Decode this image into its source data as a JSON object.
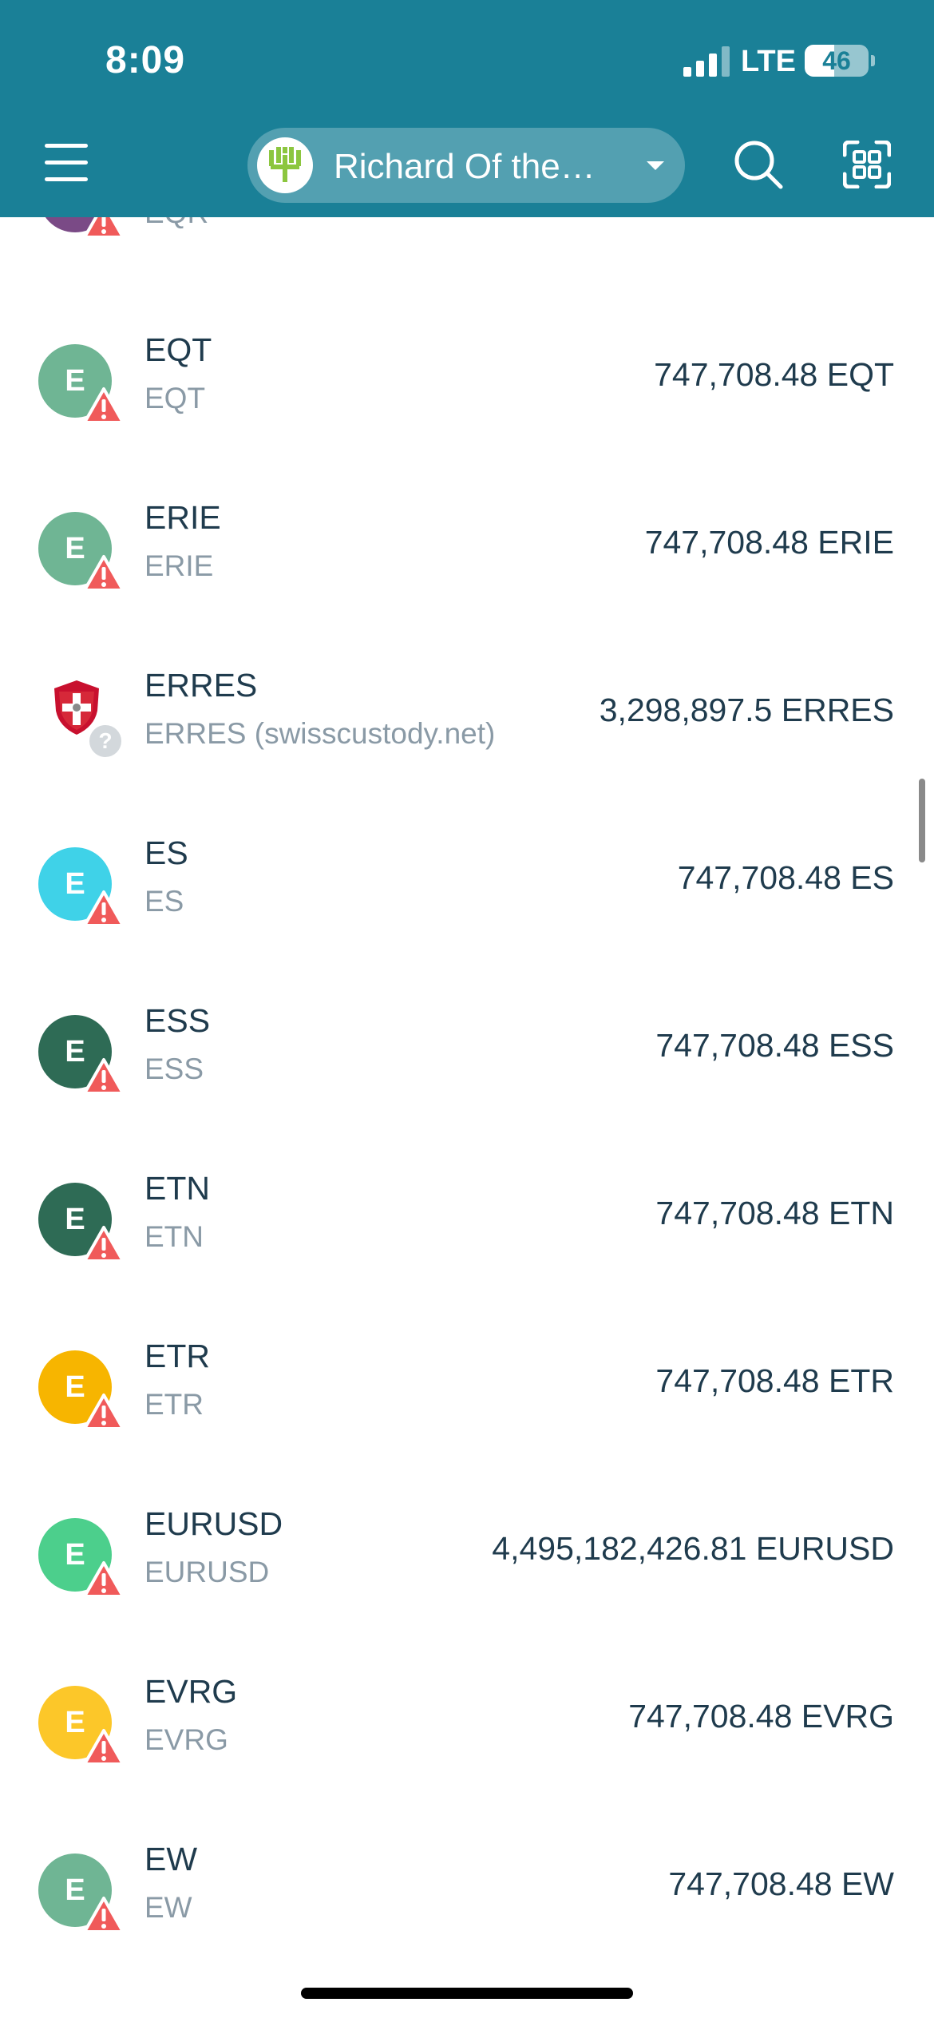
{
  "status_bar": {
    "time": "8:09",
    "network": "LTE",
    "battery": "46",
    "battery_level": 0.46
  },
  "header": {
    "wallet_name": "Richard Of the…",
    "menu_icon": "hamburger-menu-icon",
    "search_icon": "search-icon",
    "scan_icon": "qr-scan-icon",
    "accent": "#1a8097"
  },
  "tokens": [
    {
      "name": "",
      "sub": "EQR",
      "balance": "",
      "initial": "E",
      "color": "#7a4a86",
      "badge": "warning"
    },
    {
      "name": "EQT",
      "sub": "EQT",
      "balance": "747,708.48 EQT",
      "initial": "E",
      "color": "#6fb594",
      "badge": "warning"
    },
    {
      "name": "ERIE",
      "sub": "ERIE",
      "balance": "747,708.48 ERIE",
      "initial": "E",
      "color": "#6fb594",
      "badge": "warning"
    },
    {
      "name": "ERRES",
      "sub": "ERRES (swisscustody.net)",
      "balance": "3,298,897.5 ERRES",
      "initial": "",
      "color": "#ffffff",
      "badge": "unknown",
      "icon": "shield-cross-icon"
    },
    {
      "name": "ES",
      "sub": "ES",
      "balance": "747,708.48 ES",
      "initial": "E",
      "color": "#3fd2e8",
      "badge": "warning"
    },
    {
      "name": "ESS",
      "sub": "ESS",
      "balance": "747,708.48 ESS",
      "initial": "E",
      "color": "#2e6b55",
      "badge": "warning"
    },
    {
      "name": "ETN",
      "sub": "ETN",
      "balance": "747,708.48 ETN",
      "initial": "E",
      "color": "#2e6b55",
      "badge": "warning"
    },
    {
      "name": "ETR",
      "sub": "ETR",
      "balance": "747,708.48 ETR",
      "initial": "E",
      "color": "#f7b500",
      "badge": "warning"
    },
    {
      "name": "EURUSD",
      "sub": "EURUSD",
      "balance": "4,495,182,426.81 EURUSD",
      "initial": "E",
      "color": "#4ccf8c",
      "badge": "warning"
    },
    {
      "name": "EVRG",
      "sub": "EVRG",
      "balance": "747,708.48 EVRG",
      "initial": "E",
      "color": "#fcc729",
      "badge": "warning"
    },
    {
      "name": "EW",
      "sub": "EW",
      "balance": "747,708.48 EW",
      "initial": "E",
      "color": "#6fb594",
      "badge": "warning"
    }
  ],
  "warning_color": "#f05a5a"
}
